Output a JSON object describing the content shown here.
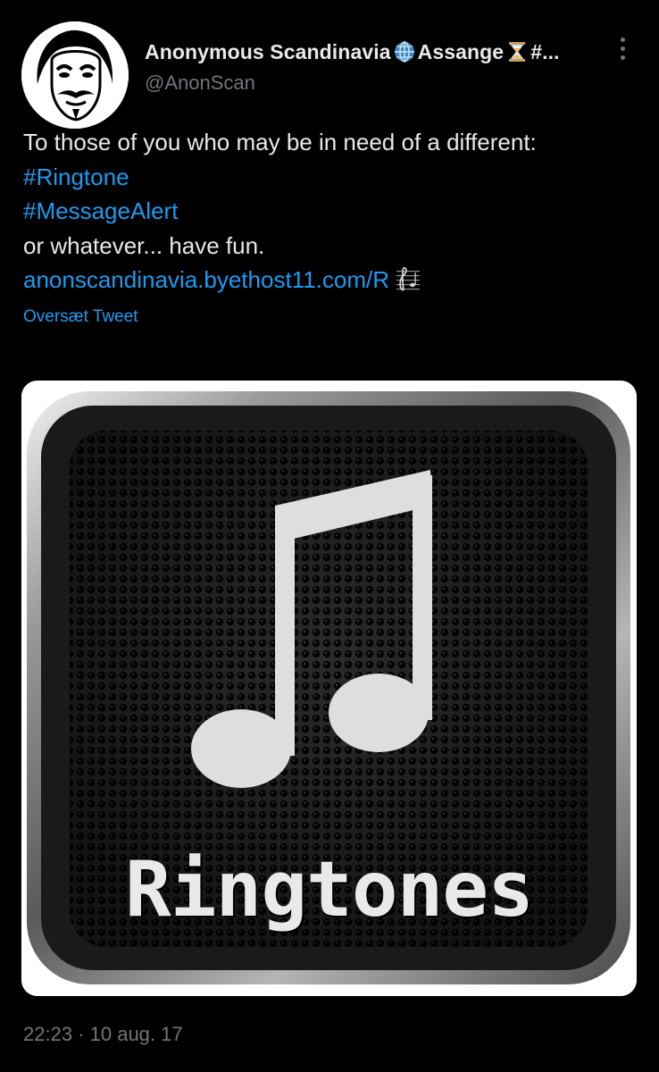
{
  "author": {
    "display_name_part1": "Anonymous Scandinavia",
    "display_name_part2": " Assange",
    "display_name_part3": " #...",
    "handle": "@AnonScan",
    "avatar_icon": "guy-fawkes-mask-icon"
  },
  "tweet": {
    "line1": "To those of you who may be in need of a different:",
    "hashtag1": "#Ringtone",
    "hashtag2": "#MessageAlert",
    "line4": "or whatever... have fun.",
    "link": "anonscandinavia.byethost11.com/R",
    "link_emoji": "musical-score-icon",
    "translate_label": "Oversæt Tweet"
  },
  "media": {
    "caption": "Ringtones",
    "icon": "music-note-icon"
  },
  "meta": {
    "time": "22:23",
    "separator": " · ",
    "date": "10 aug. 17"
  },
  "colors": {
    "background": "#000000",
    "text": "#e7e9ea",
    "secondary": "#71767b",
    "link": "#1d9bf0"
  }
}
